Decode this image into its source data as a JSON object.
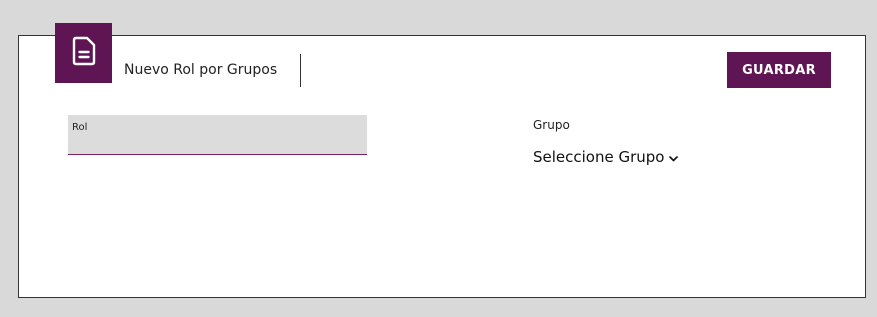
{
  "header": {
    "title": "Nuevo Rol por Grupos",
    "save_label": "GUARDAR",
    "icon": "document-icon"
  },
  "form": {
    "rol": {
      "label": "Rol",
      "value": ""
    },
    "grupo": {
      "label": "Grupo",
      "selected": "Seleccione Grupo"
    }
  },
  "colors": {
    "accent": "#5f1553",
    "background": "#d9d9d9",
    "card": "#ffffff"
  }
}
